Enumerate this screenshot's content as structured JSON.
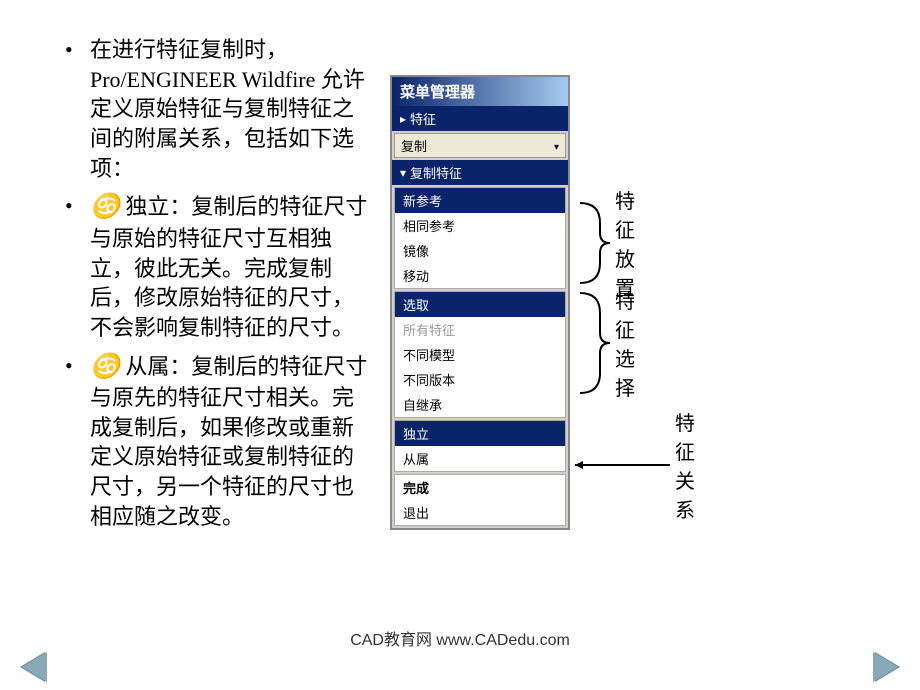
{
  "bullets": {
    "b1": "在进行特征复制时，Pro/ENGINEER Wildfire 允许定义原始特征与复制特征之间的附属关系，包括如下选项：",
    "b2_prefix": "独立：",
    "b2_body": "复制后的特征尺寸与原始的特征尺寸互相独立，彼此无关。完成复制后，修改原始特征的尺寸，不会影响复制特征的尺寸。",
    "b3_prefix": "从属：",
    "b3_body": "复制后的特征尺寸与原先的特征尺寸相关。完成复制后，如果修改或重新定义原始特征或复制特征的尺寸，另一个特征的尺寸也相应随之改变。"
  },
  "menu": {
    "title": "菜单管理器",
    "header_feature": "特征",
    "dropdown_copy": "复制",
    "header_copy_feature": "复制特征",
    "placement": {
      "new_ref": "新参考",
      "same_ref": "相同参考",
      "mirror": "镜像",
      "move": "移动"
    },
    "selection": {
      "select": "选取",
      "all_features": "所有特征",
      "diff_model": "不同模型",
      "diff_version": "不同版本",
      "inherit": "自继承"
    },
    "relation": {
      "independent": "独立",
      "dependent": "从属"
    },
    "actions": {
      "done": "完成",
      "quit": "退出"
    }
  },
  "labels": {
    "placement": "特征放置",
    "selection": "特征选择",
    "relation": "特征关系"
  },
  "footer": "CAD教育网 www.CADedu.com"
}
